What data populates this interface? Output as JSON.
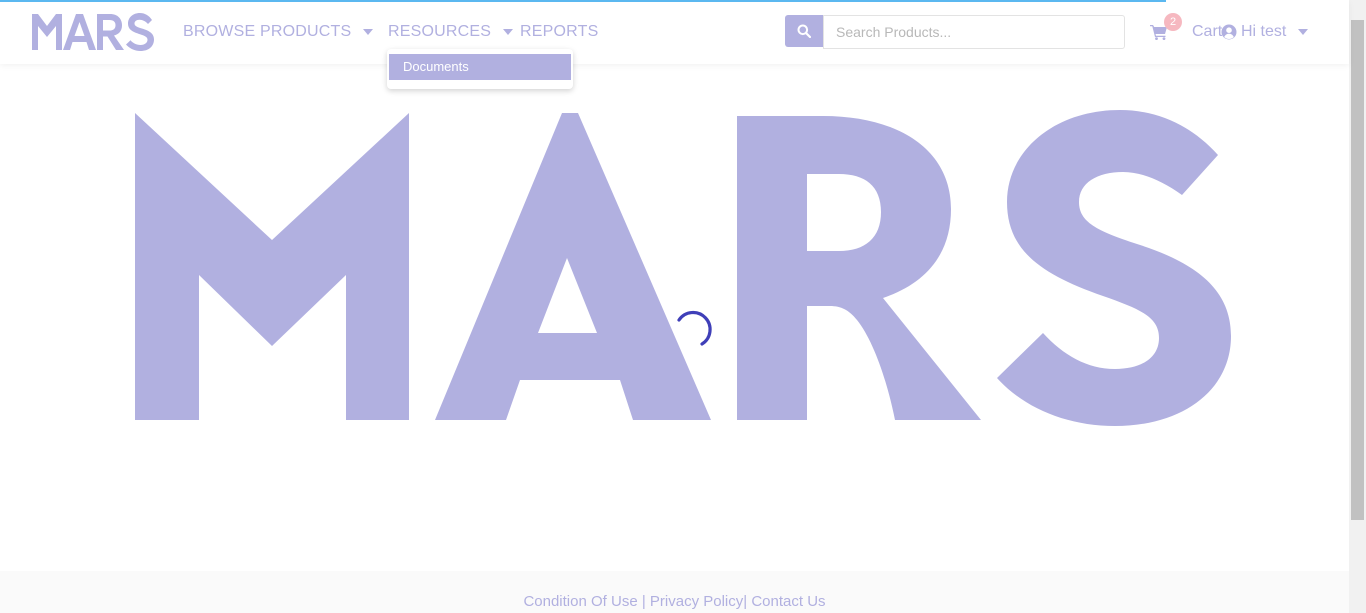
{
  "brand": {
    "logo_text": "MARS",
    "color": "#b1b0e0"
  },
  "nav": {
    "items": [
      {
        "label": "BROWSE PRODUCTS",
        "has_caret": true
      },
      {
        "label": "RESOURCES",
        "has_caret": true
      },
      {
        "label": "REPORTS",
        "has_caret": false
      }
    ],
    "resources_dropdown": {
      "items": [
        {
          "label": "Documents",
          "selected": true
        }
      ]
    }
  },
  "search": {
    "placeholder": "Search Products...",
    "value": "",
    "icon": "search-icon"
  },
  "cart": {
    "label": "Cart",
    "count": "2",
    "icon": "cart-icon"
  },
  "user": {
    "greeting": "Hi test",
    "icon": "user-circle-icon"
  },
  "hero": {
    "logo_text": "MARS",
    "loading": true
  },
  "footer": {
    "links": [
      "Condition Of Use",
      "Privacy Policy",
      "Contact Us"
    ],
    "separators": [
      " | ",
      "| "
    ]
  },
  "colors": {
    "accent": "#b1b0e0",
    "spinner": "#3f3fb8",
    "badge": "#f6b8c0",
    "load_bar": "#5bb8f0"
  }
}
